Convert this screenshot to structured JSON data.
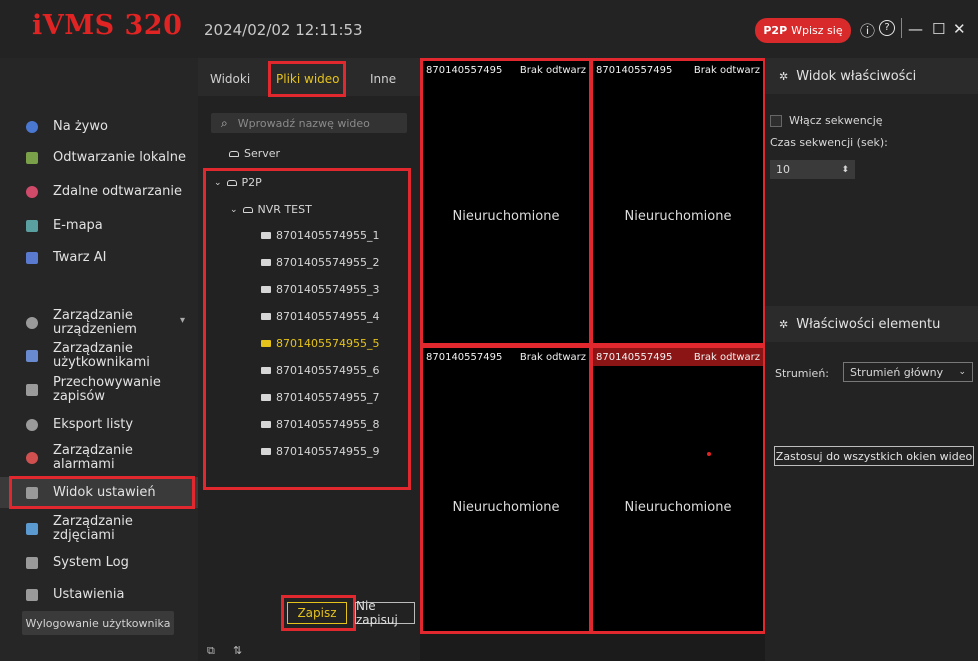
{
  "app": {
    "logo": "iVMS 320",
    "datetime": "2024/02/02 12:11:53"
  },
  "topbar": {
    "p2p_label": "P2P",
    "login_label": "Wpisz się",
    "info": "ⓘ",
    "help": "?",
    "minimize": "—",
    "maximize": "☐",
    "close": "✕"
  },
  "sidebar": {
    "items": [
      {
        "label": "Na żywo",
        "icon": "live-icon",
        "color": "#4a78d0"
      },
      {
        "label": "Odtwarzanie lokalne",
        "icon": "local-playback-icon",
        "color": "#7aa04a"
      },
      {
        "label": "Zdalne odtwarzanie",
        "icon": "remote-playback-icon",
        "color": "#d04a6a"
      },
      {
        "label": "E-mapa",
        "icon": "emap-icon",
        "color": "#5aa0a0"
      },
      {
        "label": "Twarz AI",
        "icon": "face-ai-icon",
        "color": "#5a7ad0"
      },
      {
        "label": "Zarządzanie urządzeniem",
        "icon": "device-icon",
        "color": "#9a9a9a"
      },
      {
        "label": "Zarządzanie użytkownikami",
        "icon": "user-icon",
        "color": "#6a8ad0"
      },
      {
        "label": "Przechowywanie zapisów",
        "icon": "storage-icon",
        "color": "#9a9a9a"
      },
      {
        "label": "Eksport listy",
        "icon": "export-icon",
        "color": "#9a9a9a"
      },
      {
        "label": "Zarządzanie alarmami",
        "icon": "alarm-icon",
        "color": "#d05050"
      },
      {
        "label": "Widok ustawień",
        "icon": "view-settings-icon",
        "color": "#9a9a9a"
      },
      {
        "label": "Zarządzanie zdjęciami",
        "icon": "picture-icon",
        "color": "#5a9ad0"
      },
      {
        "label": "System Log",
        "icon": "log-icon",
        "color": "#9a9a9a"
      },
      {
        "label": "Ustawienia",
        "icon": "settings-icon",
        "color": "#9a9a9a"
      }
    ],
    "logout": "Wylogowanie użytkownika"
  },
  "tabs": [
    {
      "label": "Widoki"
    },
    {
      "label": "Pliki wideo"
    },
    {
      "label": "Inne"
    }
  ],
  "search": {
    "placeholder": "Wprowadź nazwę wideo"
  },
  "tree": {
    "server": "Server",
    "p2p": "P2P",
    "nvr": "NVR TEST",
    "cameras": [
      "8701405574955_1",
      "8701405574955_2",
      "8701405574955_3",
      "8701405574955_4",
      "8701405574955_5",
      "8701405574955_6",
      "8701405574955_7",
      "8701405574955_8",
      "8701405574955_9"
    ]
  },
  "buttons": {
    "save": "Zapisz",
    "nosave": "Nie zapisuj"
  },
  "video": {
    "header_id": "870140557495",
    "header_status": "Brak odtwarz",
    "message": "Nieuruchomione"
  },
  "right": {
    "view_props_title": "Widok właściwości",
    "seq_checkbox": "Włącz sekwencję",
    "seq_time_label": "Czas sekwencji (sek):",
    "seq_time_value": "10",
    "elem_props_title": "Właściwości elementu",
    "stream_label": "Strumień:",
    "stream_value": "Strumień główny",
    "apply_all": "Zastosuj do wszystkich okien wideo"
  },
  "colors": {
    "accent_red": "#e0282e",
    "accent_yellow": "#e6c31a",
    "logo_red": "#e02323"
  }
}
